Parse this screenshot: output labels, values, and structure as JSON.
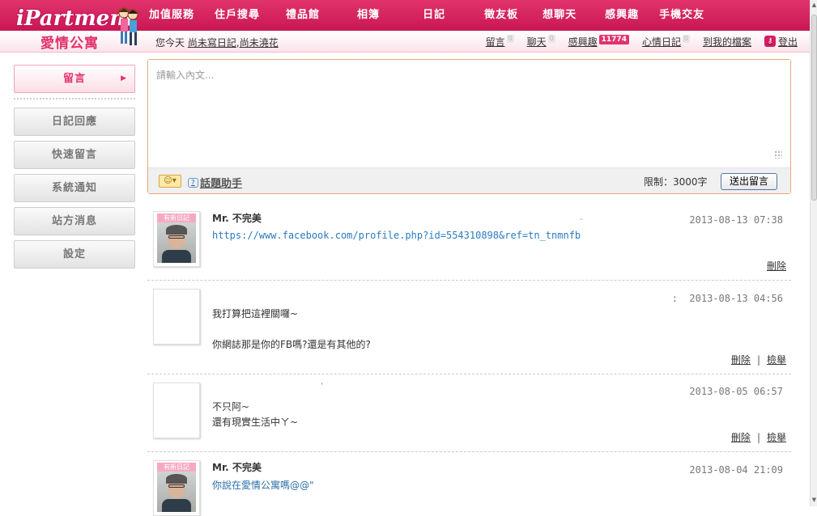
{
  "logo": {
    "wordmark": "iPartment",
    "chinese": "愛情公寓"
  },
  "main_nav": [
    "加值服務",
    "住戶搜尋",
    "禮品館",
    "相簿",
    "日記",
    "徵友板",
    "想聊天",
    "感興趣",
    "手機交友"
  ],
  "status_line": {
    "prefix": "您今天",
    "diary_link": "尚未寫日記",
    "comma": ",",
    "flower_link": "尚未澆花"
  },
  "user_nav": [
    {
      "label": "留言",
      "count": "0"
    },
    {
      "label": "聊天",
      "count": "0"
    },
    {
      "label": "感興趣",
      "count": "11774"
    },
    {
      "label": "心情日記",
      "count": "0"
    },
    {
      "label": "到我的檔案",
      "count": ""
    }
  ],
  "logout": {
    "label": "登出",
    "icon": "key-icon"
  },
  "sidebar": {
    "items": [
      {
        "label": "留言",
        "active": true
      },
      {
        "label": "日記回應"
      },
      {
        "label": "快速留言"
      },
      {
        "label": "系統通知"
      },
      {
        "label": "站方消息"
      },
      {
        "label": "設定"
      }
    ]
  },
  "composer": {
    "placeholder": "請輸入內文...",
    "value": "",
    "emoji_icon": "smiley-icon",
    "topic_helper": "話題助手",
    "limit": "限制：3000字",
    "send": "送出留言"
  },
  "messages": [
    {
      "author": "Mr. 不完美",
      "time": "2013-08-13 07:38",
      "avatar_tag": "有新日記",
      "link": "https://www.facebook.com/profile.php?id=554310898&ref=tn_tnmnfb",
      "stray": "-",
      "actions": [
        "刪除"
      ]
    },
    {
      "author": "",
      "time": "2013-08-13 04:56",
      "time_prefix": ":",
      "text": "我打算把這裡關囉~\n\n你網誌那是你的FB嗎?還是有其他的?",
      "actions": [
        "刪除",
        "檢舉"
      ]
    },
    {
      "author": "",
      "time": "2013-08-05 06:57",
      "stray": "'",
      "text": "不只阿~\n還有現實生活中ㄚ~",
      "actions": [
        "刪除",
        "檢舉"
      ]
    },
    {
      "author": "Mr. 不完美",
      "time": "2013-08-04 21:09",
      "avatar_tag": "有新日記",
      "text": "你說在愛情公寓嗎@@\"",
      "actions": []
    }
  ],
  "action_separator": "|",
  "colors": {
    "brand": "#e2336c",
    "link": "#2a7ac0",
    "composer_border": "#e8a87c"
  }
}
